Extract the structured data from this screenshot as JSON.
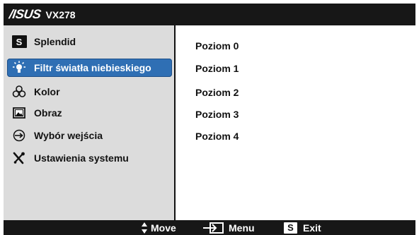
{
  "header": {
    "brand": "/ISUS",
    "model": "VX278"
  },
  "sidebar": {
    "items": [
      {
        "label": "Splendid",
        "icon": "splendid-s-icon"
      },
      {
        "label": "Filtr światła niebieskiego",
        "icon": "blue-light-filter-icon",
        "selected": true
      },
      {
        "label": "Kolor",
        "icon": "color-icon"
      },
      {
        "label": "Obraz",
        "icon": "image-icon"
      },
      {
        "label": "Wybór wejścia",
        "icon": "input-select-icon"
      },
      {
        "label": "Ustawienia systemu",
        "icon": "system-setup-icon"
      }
    ]
  },
  "main": {
    "options": [
      "Poziom 0",
      "Poziom 1",
      "Poziom 2",
      "Poziom 3",
      "Poziom 4"
    ]
  },
  "footer": {
    "move_label": "Move",
    "menu_label": "Menu",
    "exit_label": "Exit",
    "exit_key": "S"
  },
  "colors": {
    "selected": "#2f6fb4",
    "bar": "#171717",
    "sidebar": "#dcdcdc"
  }
}
